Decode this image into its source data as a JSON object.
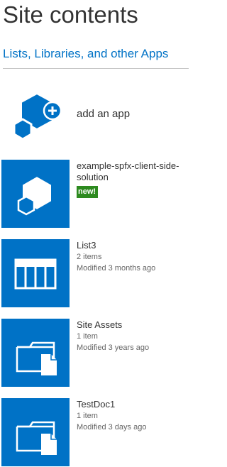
{
  "page": {
    "title": "Site contents",
    "section_title": "Lists, Libraries, and other Apps"
  },
  "add_app": {
    "label": "add an app",
    "icon": "add-app-icon"
  },
  "items": [
    {
      "name": "example-spfx-client-side-solution",
      "badge": "new!",
      "icon": "app-icon"
    },
    {
      "name": "List3",
      "count": "2 items",
      "modified": "Modified 3 months ago",
      "icon": "list-icon"
    },
    {
      "name": "Site Assets",
      "count": "1 item",
      "modified": "Modified 3 years ago",
      "icon": "document-library-icon"
    },
    {
      "name": "TestDoc1",
      "count": "1 item",
      "modified": "Modified 3 days ago",
      "icon": "document-library-icon"
    }
  ],
  "colors": {
    "tile": "#0072c6",
    "accent": "#0072c6",
    "badge": "#2d8a1f"
  }
}
